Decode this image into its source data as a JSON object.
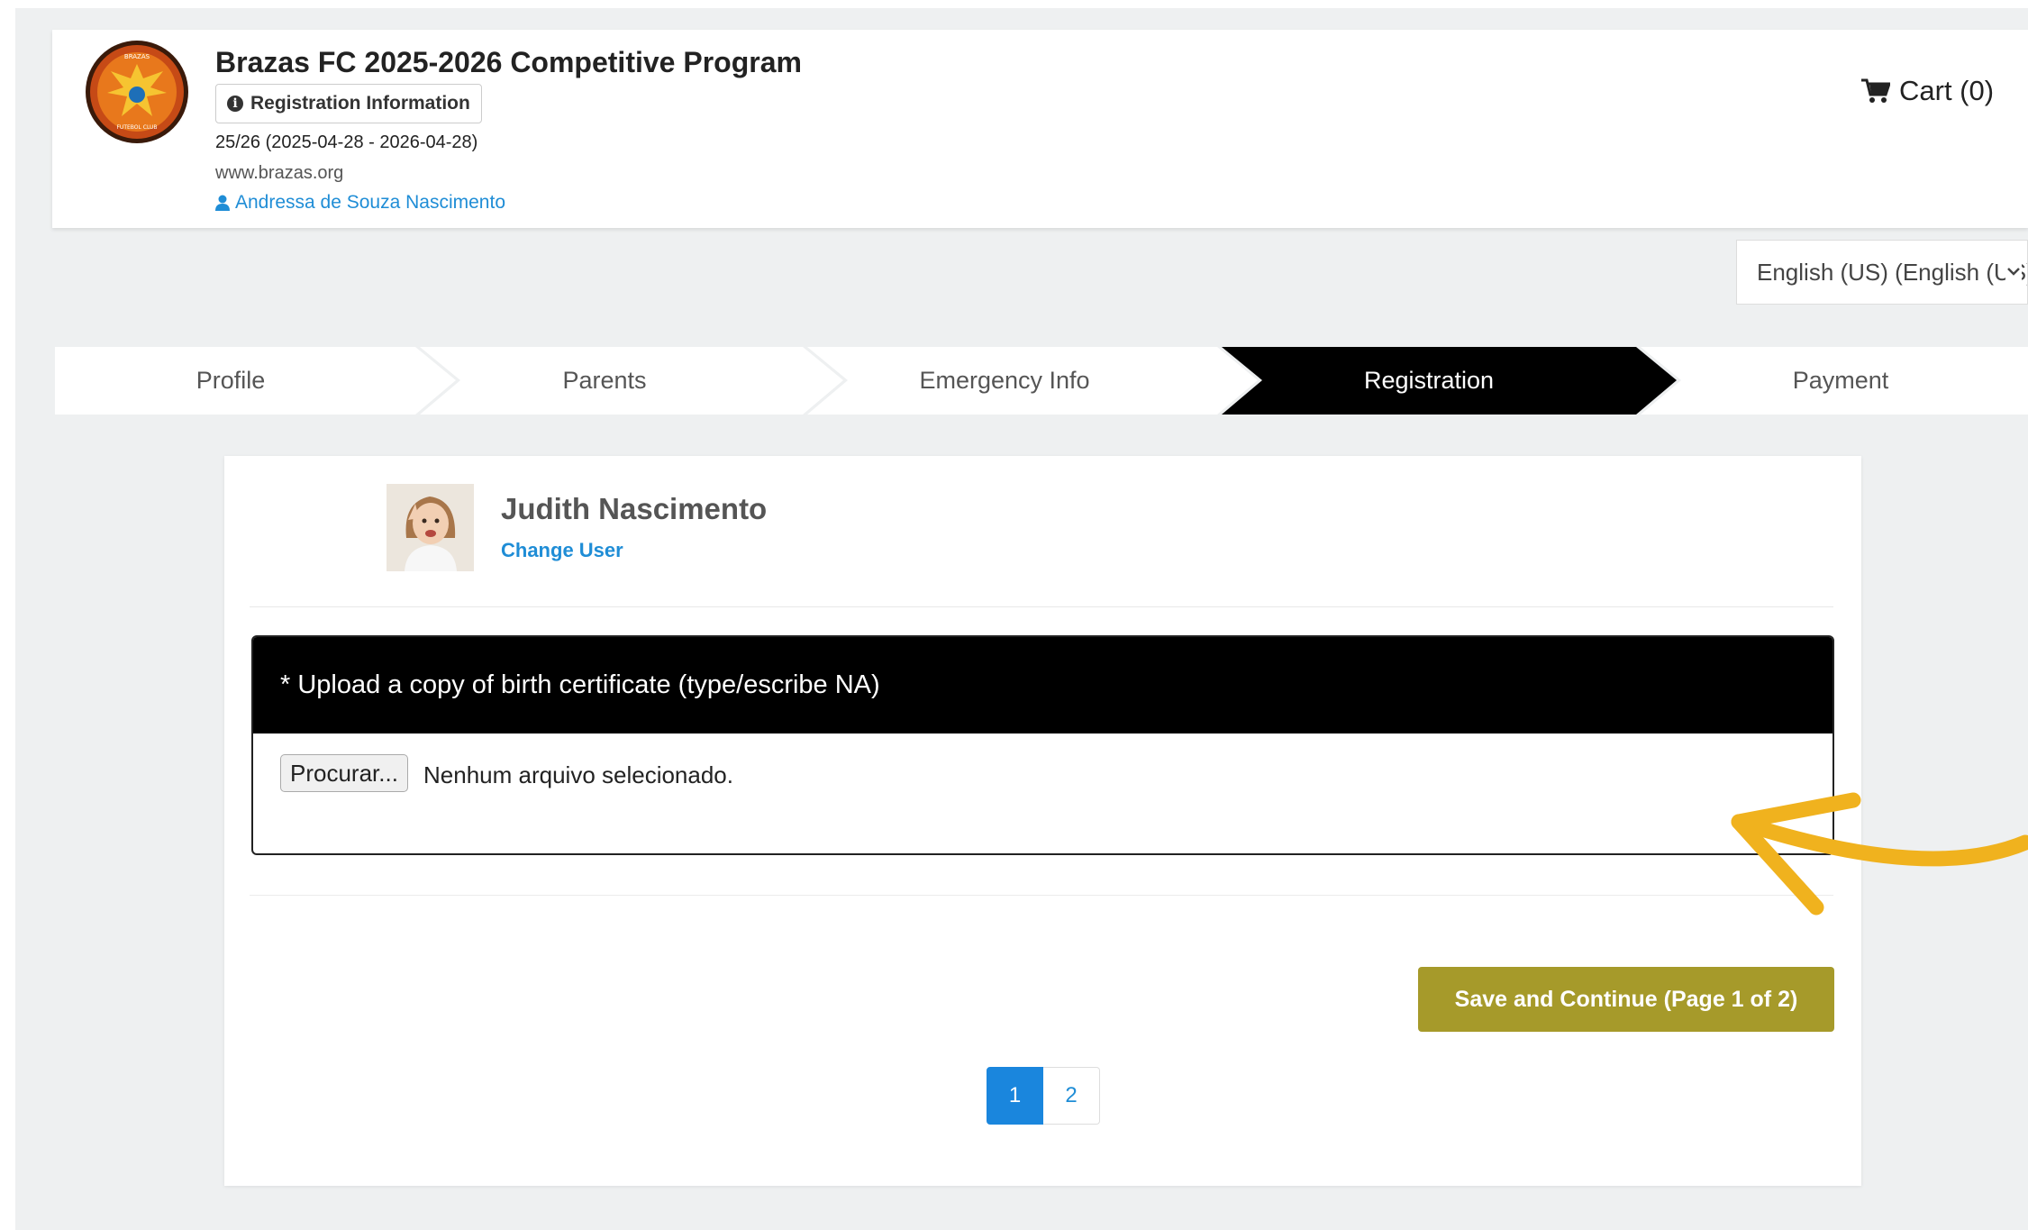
{
  "header": {
    "org_title": "Brazas FC 2025-2026 Competitive Program",
    "registration_info_label": "Registration Information",
    "season": "25/26 (2025-04-28 - 2026-04-28)",
    "website": "www.brazas.org",
    "user_name": "Andressa de Souza Nascimento",
    "cart_label": "Cart (0)",
    "logo_text_top": "BRAZAS",
    "logo_text_bottom": "FUTEBOL CLUB"
  },
  "language": {
    "selected": "English (US) (English (US))"
  },
  "steps": [
    {
      "label": "Profile",
      "active": false
    },
    {
      "label": "Parents",
      "active": false
    },
    {
      "label": "Emergency Info",
      "active": false
    },
    {
      "label": "Registration",
      "active": true
    },
    {
      "label": "Payment",
      "active": false
    }
  ],
  "member": {
    "name": "Judith Nascimento",
    "change_user_label": "Change User"
  },
  "upload": {
    "question": "* Upload a copy of birth certificate (type/escribe NA)",
    "browse_label": "Procurar...",
    "file_status": "Nenhum arquivo selecionado."
  },
  "actions": {
    "save_label": "Save and Continue (Page 1 of 2)"
  },
  "pagination": {
    "pages": [
      "1",
      "2"
    ],
    "current": "1"
  },
  "colors": {
    "accent": "#a69a2a",
    "link": "#1f8dd6",
    "annotation_arrow": "#f0b21e"
  }
}
